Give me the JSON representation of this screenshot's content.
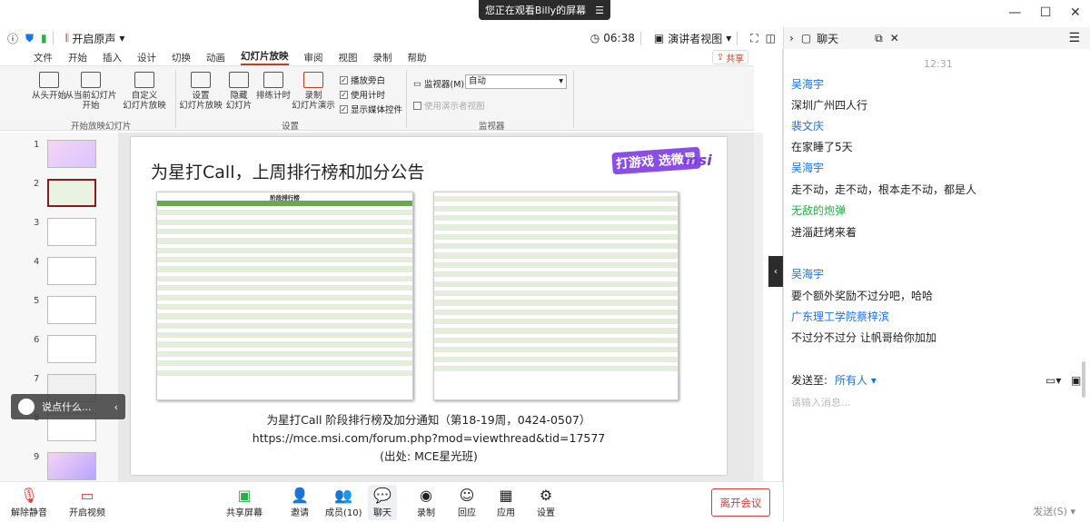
{
  "banner": {
    "text": "您正在观看Billy的屏幕"
  },
  "toolbar": {
    "unmute_original": "开启原声",
    "time": "06:38",
    "presenter_view": "演讲者视图"
  },
  "ppt": {
    "tabs": [
      "文件",
      "开始",
      "插入",
      "设计",
      "切换",
      "动画",
      "幻灯片放映",
      "审阅",
      "视图",
      "录制",
      "帮助"
    ],
    "active_tab": "幻灯片放映",
    "share": "共享",
    "ribbon": {
      "from_start": "从头开始",
      "from_current": "从当前幻灯片\n开始",
      "custom": "自定义\n幻灯片放映",
      "group1": "开始放映幻灯片",
      "setup": "设置\n幻灯片放映",
      "hide": "隐藏\n幻灯片",
      "rehearse": "排练计时",
      "record": "录制\n幻灯片演示",
      "play_narration": "播放旁白",
      "use_timing": "使用计时",
      "show_controls": "显示媒体控件",
      "group2": "设置",
      "monitor_label": "监视器(M):",
      "monitor_value": "自动",
      "presenter_view": "使用演示者视图",
      "group3": "监视器"
    },
    "thumb_numbers": [
      "1",
      "2",
      "3",
      "4",
      "5",
      "6",
      "7",
      "8",
      "9"
    ],
    "slide": {
      "title": "为星打Call，上周排行榜和加分公告",
      "logo_text": "打游戏 选微星",
      "logo_msi": "msi",
      "table_title": "阶段排行榜",
      "caption1": "为星打Call 阶段排行榜及加分通知（第18-19周，0424-0507）",
      "caption2": "https://mce.msi.com/forum.php?mod=viewthread&tid=17577",
      "caption3": "(出处: MCE星光班)"
    }
  },
  "overlay": {
    "placeholder": "说点什么..."
  },
  "chat": {
    "title": "聊天",
    "time": "12:31",
    "messages": [
      {
        "name": "吴海宇",
        "text": "深圳广州四人行",
        "color": "blue"
      },
      {
        "name": "裴文庆",
        "text": "在家睡了5天",
        "color": "blue"
      },
      {
        "name": "吴海宇",
        "text": "走不动，走不动，根本走不动，都是人",
        "color": "blue"
      },
      {
        "name": "无敌的炮弹",
        "text": "进淄赶烤来着",
        "color": "green"
      },
      {
        "name": "吴海宇",
        "text": "要个额外奖励不过分吧，哈哈",
        "color": "blue"
      },
      {
        "name": "广东理工学院蔡梓滨",
        "text": "不过分不过分 让帆哥给你加加",
        "color": "blue"
      }
    ],
    "send_to_label": "发送至:",
    "send_to_value": "所有人",
    "input_placeholder": "请输入消息...",
    "send_button": "发送(S)"
  },
  "bottom": {
    "mute": "解除静音",
    "video": "开启视频",
    "share": "共享屏幕",
    "invite": "邀请",
    "members": "成员(10)",
    "chat": "聊天",
    "record": "录制",
    "reaction": "回应",
    "apps": "应用",
    "settings": "设置",
    "leave": "离开会议"
  },
  "colors": {
    "accent": "#c43e1c",
    "link": "#1a73e8",
    "leave": "#e03a3a"
  }
}
